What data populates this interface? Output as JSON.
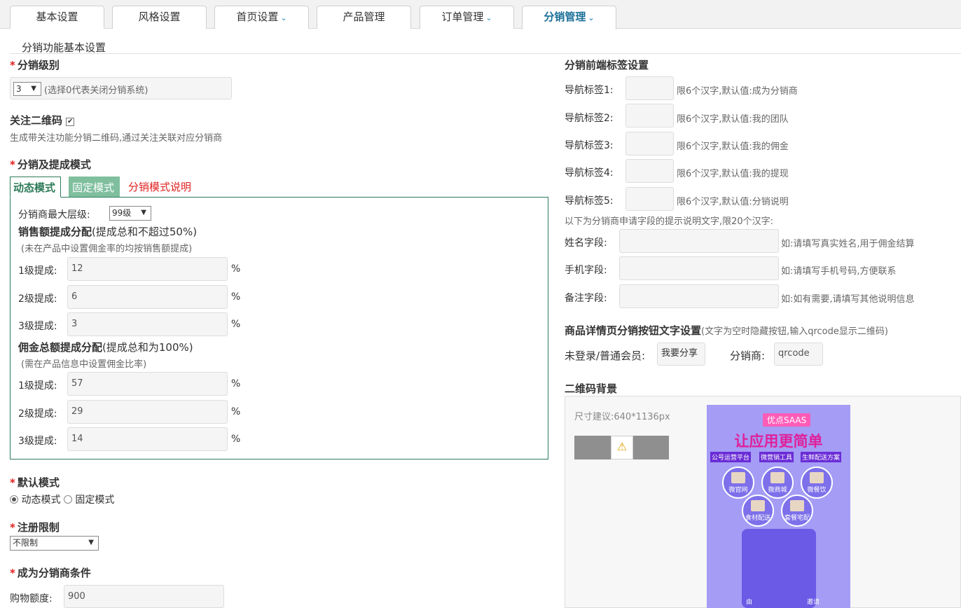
{
  "tabs": [
    {
      "label": "基本设置",
      "dropdown": false
    },
    {
      "label": "风格设置",
      "dropdown": false
    },
    {
      "label": "首页设置",
      "dropdown": true
    },
    {
      "label": "产品管理",
      "dropdown": false
    },
    {
      "label": "订单管理",
      "dropdown": true
    },
    {
      "label": "分销管理",
      "dropdown": true,
      "active": true
    }
  ],
  "section_title": "分销功能基本设置",
  "level": {
    "label": "分销级别",
    "value": "3",
    "hint": "(选择0代表关闭分销系统)"
  },
  "qrcode_follow": {
    "label": "关注二维码",
    "checked": true,
    "desc": "生成带关注功能分销二维码,通过关注关联对应分销商"
  },
  "mode_section": {
    "label": "分销及提成模式",
    "tabs": [
      "动态模式",
      "固定模式",
      "分销模式说明"
    ],
    "max_level_label": "分销商最大层级:",
    "max_level_value": "99级",
    "sales_title": "销售额提成分配",
    "sales_note": "(提成总和不超过50%)",
    "sales_sub": "(未在产品中设置佣金率的均按销售额提成)",
    "sales_rows": [
      {
        "label": "1级提成:",
        "value": "12",
        "unit": "%"
      },
      {
        "label": "2级提成:",
        "value": "6",
        "unit": "%"
      },
      {
        "label": "3级提成:",
        "value": "3",
        "unit": "%"
      }
    ],
    "commission_title": "佣金总额提成分配",
    "commission_note": "(提成总和为100%)",
    "commission_sub": "(需在产品信息中设置佣金比率)",
    "commission_rows": [
      {
        "label": "1级提成:",
        "value": "57",
        "unit": "%"
      },
      {
        "label": "2级提成:",
        "value": "29",
        "unit": "%"
      },
      {
        "label": "3级提成:",
        "value": "14",
        "unit": "%"
      }
    ]
  },
  "default_mode": {
    "label": "默认模式",
    "options": [
      "动态模式",
      "固定模式"
    ],
    "selected": "动态模式"
  },
  "register_limit": {
    "label": "注册限制",
    "value": "不限制"
  },
  "become_condition": {
    "label": "成为分销商条件",
    "field_label": "购物额度:",
    "value": "900"
  },
  "front_tags": {
    "title": "分销前端标签设置",
    "rows": [
      {
        "label": "导航标签1:",
        "hint": "限6个汉字,默认值:成为分销商"
      },
      {
        "label": "导航标签2:",
        "hint": "限6个汉字,默认值:我的团队"
      },
      {
        "label": "导航标签3:",
        "hint": "限6个汉字,默认值:我的佣金"
      },
      {
        "label": "导航标签4:",
        "hint": "限6个汉字,默认值:我的提现"
      },
      {
        "label": "导航标签5:",
        "hint": "限6个汉字,默认值:分销说明"
      }
    ],
    "apply_note": "以下为分销商申请字段的提示说明文字,限20个汉字:",
    "fields": [
      {
        "label": "姓名字段:",
        "hint": "如:请填写真实姓名,用于佣金结算"
      },
      {
        "label": "手机字段:",
        "hint": "如:请填写手机号码,方便联系"
      },
      {
        "label": "备注字段:",
        "hint": "如:如有需要,请填写其他说明信息"
      }
    ]
  },
  "detail_button": {
    "title": "商品详情页分销按钮文字设置",
    "note": "(文字为空时隐藏按钮,输入qrcode显示二维码)",
    "member_label": "未登录/普通会员:",
    "member_value": "我要分享",
    "dist_label": "分销商:",
    "dist_value": "qrcode"
  },
  "qr_bg": {
    "title": "二维码背景",
    "size_hint": "尺寸建议:640*1136px",
    "poster": {
      "badge": "优点SAAS",
      "headline": "让应用更简单",
      "chips": [
        "公号运营平台",
        "微营销工具",
        "生鲜配送方案"
      ],
      "circles": [
        "微官网",
        "微商城",
        "微餐饮",
        "食材配送",
        "套餐宅配"
      ],
      "bottom_left": "由",
      "bottom_right": "邀请"
    }
  },
  "colors": {
    "accent": "#1b6f99",
    "active_tab_green": "#2d7a5a",
    "fixed_tab_bg": "#7fbf9e",
    "explain_red": "#e02020",
    "poster_bg": "#a49cf5"
  }
}
